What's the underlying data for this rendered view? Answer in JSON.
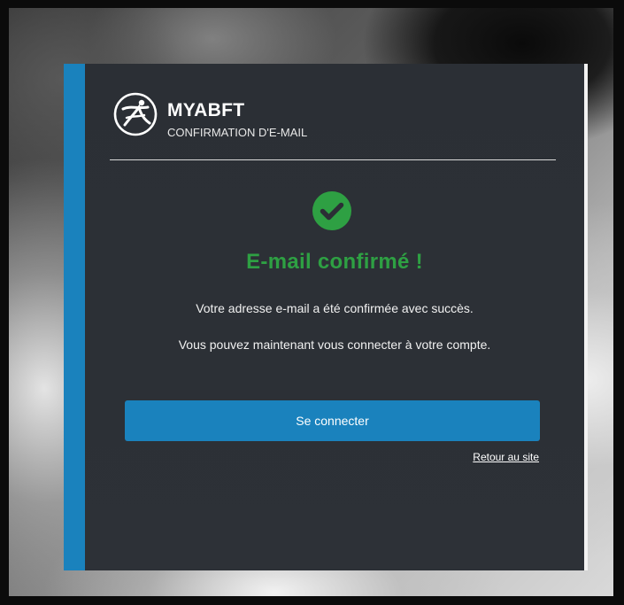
{
  "brand": {
    "name": "MYABFT",
    "subtitle": "CONFIRMATION D'E-MAIL",
    "logo_icon": "abft-logo-icon"
  },
  "status": {
    "icon": "check-circle-icon",
    "title": "E-mail confirmé !",
    "message_line1": "Votre adresse e-mail a été confirmée avec succès.",
    "message_line2": "Vous pouvez maintenant vous connecter à votre compte."
  },
  "actions": {
    "login_label": "Se connecter",
    "back_link_label": "Retour au site"
  },
  "colors": {
    "accent": "#1a82bd",
    "success": "#2ea043",
    "card_bg": "#2b2f35"
  }
}
